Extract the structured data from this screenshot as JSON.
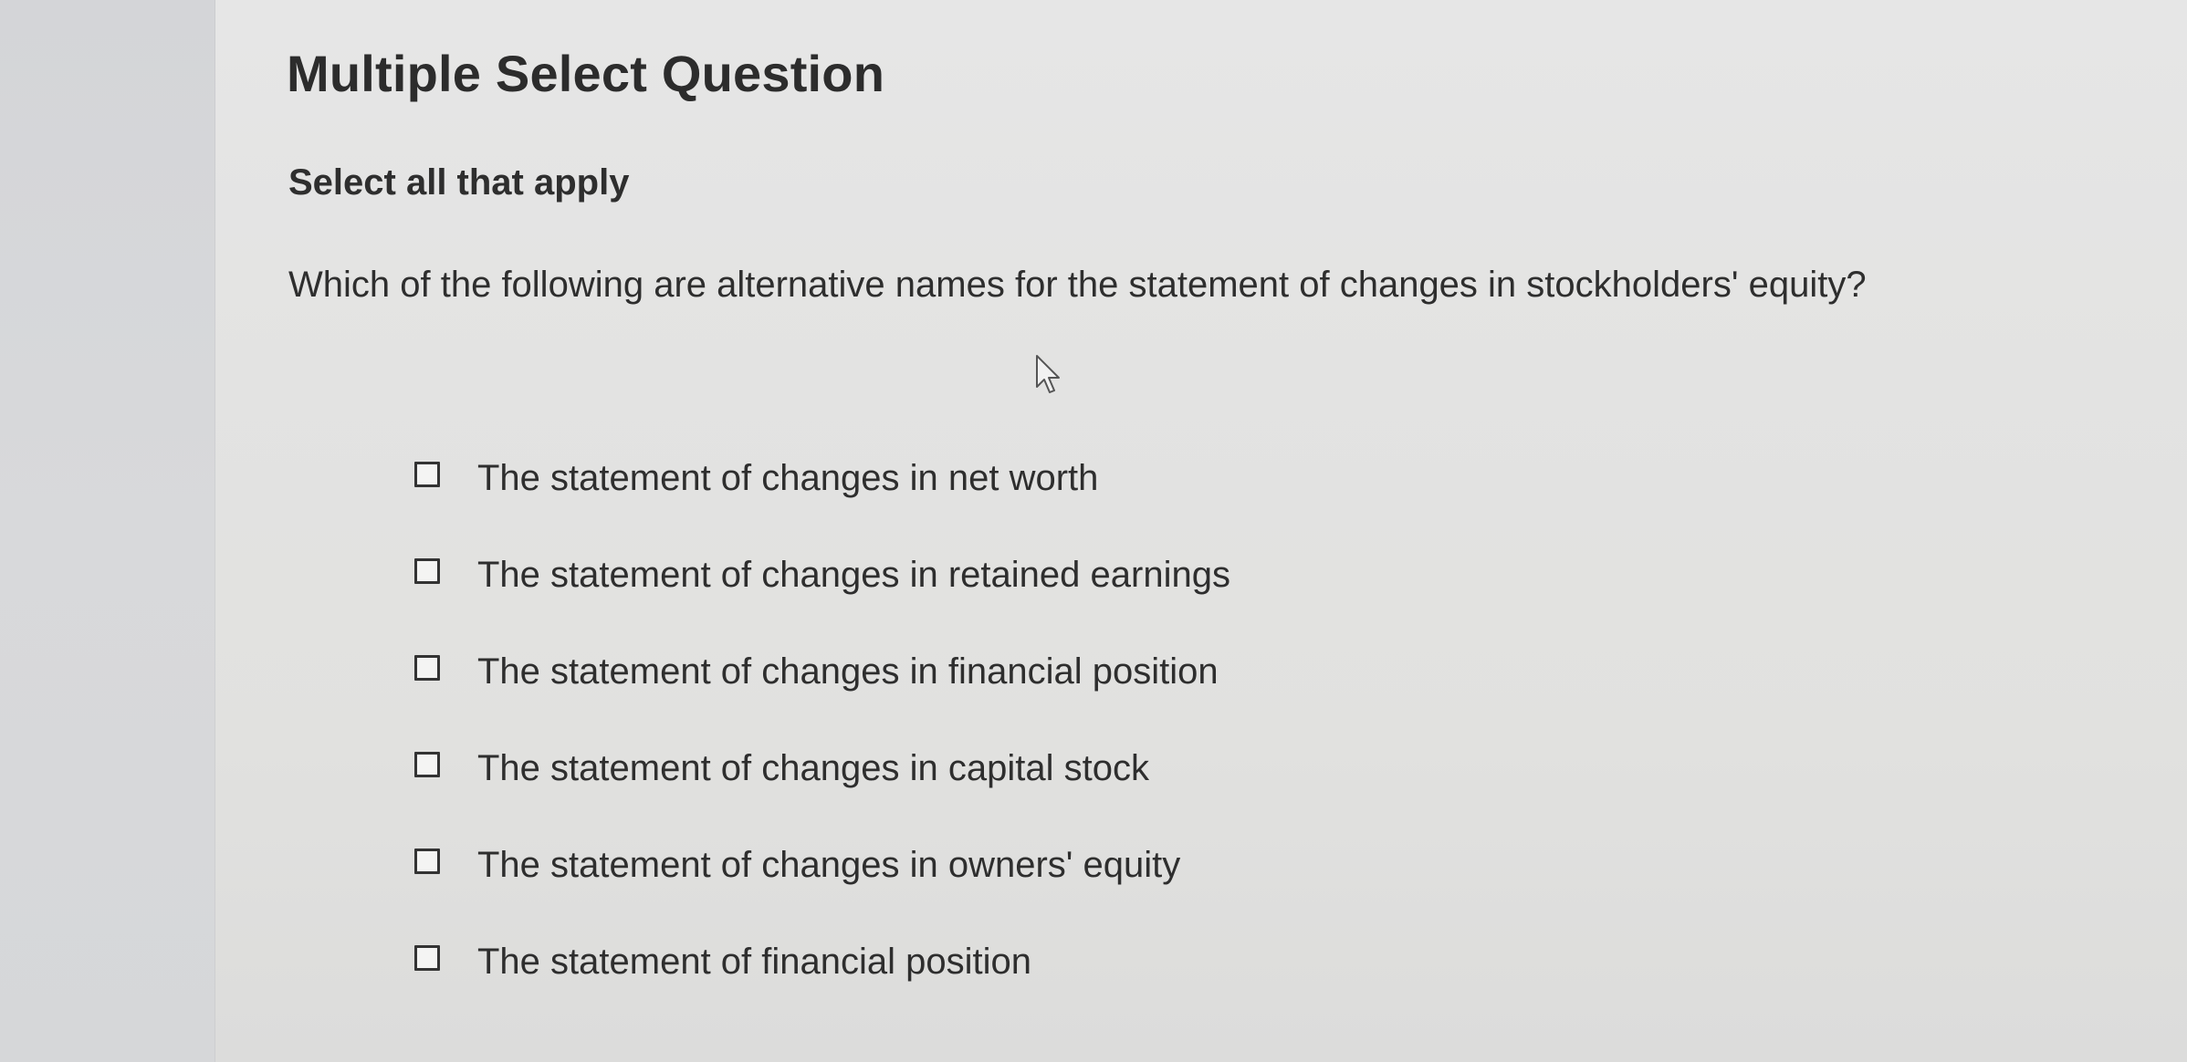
{
  "question": {
    "heading": "Multiple Select Question",
    "instruction": "Select all that apply",
    "prompt": "Which of the following are alternative names for the statement of changes in stockholders' equity?",
    "options": [
      {
        "label": "The statement of changes in net worth",
        "checked": false
      },
      {
        "label": "The statement of changes in retained earnings",
        "checked": false
      },
      {
        "label": "The statement of changes in financial position",
        "checked": false
      },
      {
        "label": "The statement of changes in capital stock",
        "checked": false
      },
      {
        "label": "The statement of changes in owners' equity",
        "checked": false
      },
      {
        "label": "The statement of financial position",
        "checked": false
      }
    ]
  },
  "icons": {
    "cursor": "mouse-pointer-icon",
    "checkbox": "checkbox-unchecked-icon"
  },
  "colors": {
    "text": "#2e2e2e",
    "background": "#e2e2e1",
    "gutter": "#d6d7d9"
  }
}
